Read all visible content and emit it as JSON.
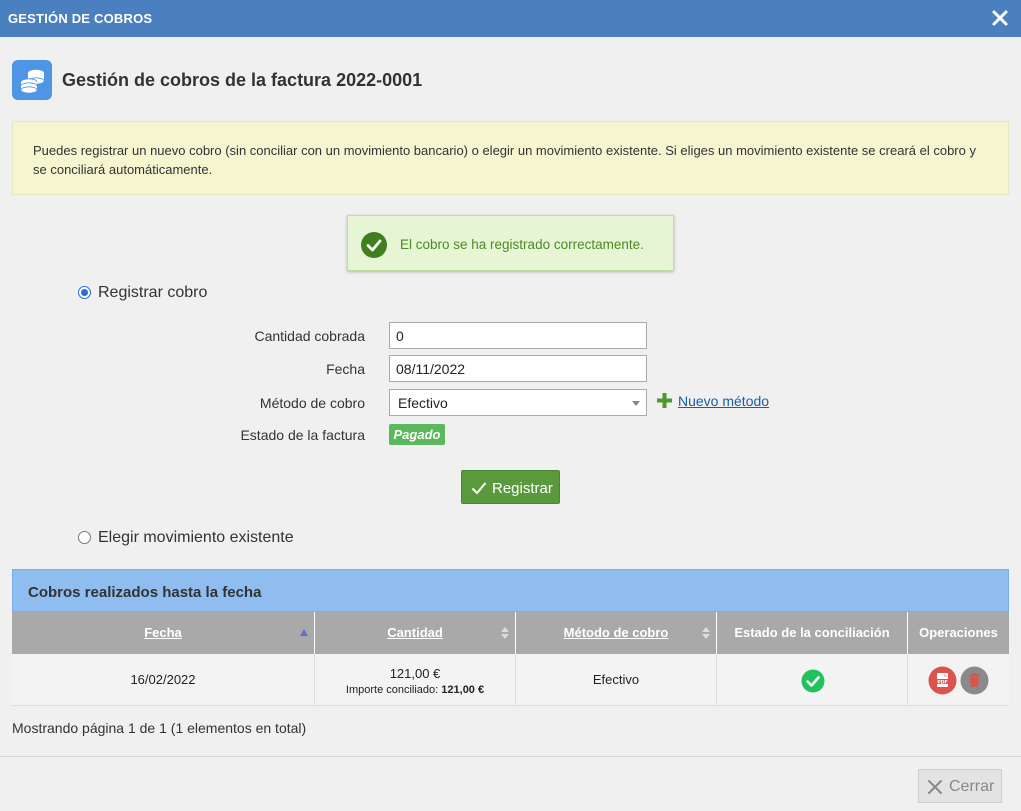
{
  "window": {
    "title": "GESTIÓN DE COBROS"
  },
  "header": {
    "title": "Gestión de cobros de la factura 2022-0001"
  },
  "info": {
    "text": "Puedes registrar un nuevo cobro (sin conciliar con un movimiento bancario) o elegir un movimiento existente. Si eliges un movimiento existente se creará el cobro y se conciliará automáticamente."
  },
  "success": {
    "text": "El cobro se ha registrado correctamente."
  },
  "options": {
    "register": {
      "label": "Registrar cobro",
      "selected": true
    },
    "existing": {
      "label": "Elegir movimiento existente",
      "selected": false
    }
  },
  "form": {
    "amount": {
      "label": "Cantidad cobrada",
      "value": "0"
    },
    "date": {
      "label": "Fecha",
      "value": "08/11/2022"
    },
    "method": {
      "label": "Método de cobro",
      "value": "Efectivo"
    },
    "new_method": "Nuevo método",
    "status": {
      "label": "Estado de la factura",
      "value": "Pagado"
    },
    "submit": "Registrar"
  },
  "payments": {
    "title": "Cobros realizados hasta la fecha",
    "columns": [
      "Fecha",
      "Cantidad",
      "Método de cobro",
      "Estado de la conciliación",
      "Operaciones"
    ],
    "rows": [
      {
        "date": "16/02/2022",
        "amount": "121,00 €",
        "reconciled_label": "Importe conciliado:",
        "reconciled_value": "121,00 €",
        "method": "Efectivo",
        "reconciled": true
      }
    ],
    "pager": "Mostrando página 1 de 1 (1 elementos en total)"
  },
  "footer": {
    "close": "Cerrar"
  },
  "colors": {
    "titlebar": "#4a7fc0",
    "success_text": "#4e8a25",
    "primary_button": "#5a9a3d",
    "badge_paid": "#5cb85c",
    "panel_head": "#8fbdf0",
    "link": "#1f5aa3"
  }
}
